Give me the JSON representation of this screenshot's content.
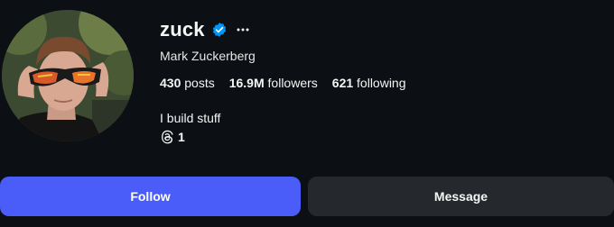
{
  "profile": {
    "username": "zuck",
    "full_name": "Mark Zuckerberg",
    "verified": true,
    "stats": {
      "posts_value": "430",
      "posts_label": "posts",
      "followers_value": "16.9M",
      "followers_label": "followers",
      "following_value": "621",
      "following_label": "following"
    },
    "bio": "I build stuff",
    "threads_count": "1"
  },
  "actions": {
    "follow_label": "Follow",
    "message_label": "Message"
  },
  "icons": {
    "verified": "verified-badge-icon",
    "more": "more-options-icon",
    "threads": "threads-icon"
  },
  "colors": {
    "background": "#0c1014",
    "follow_button": "#4a5df9",
    "message_button": "#25292e",
    "verified_badge": "#0095f6"
  }
}
